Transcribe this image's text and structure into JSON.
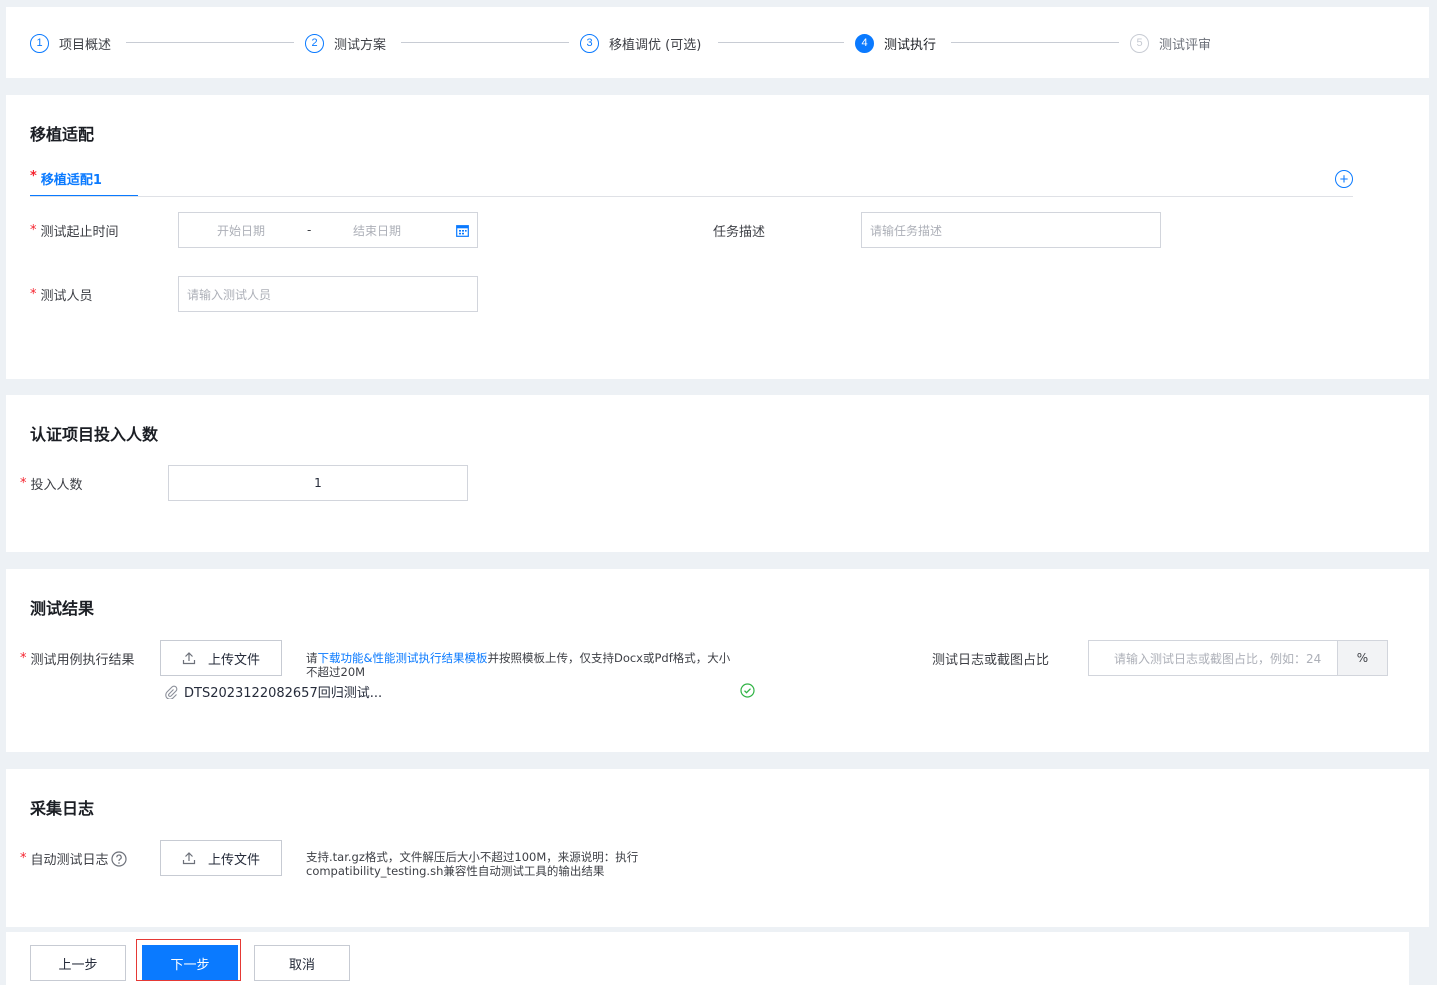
{
  "steps": [
    {
      "num": "1",
      "label": "项目概述"
    },
    {
      "num": "2",
      "label": "测试方案"
    },
    {
      "num": "3",
      "label": "移植调优 (可选)"
    },
    {
      "num": "4",
      "label": "测试执行"
    },
    {
      "num": "5",
      "label": "测试评审"
    }
  ],
  "migration": {
    "title": "移植适配",
    "tab_label": "移植适配1",
    "add_icon": "plus-circle-icon",
    "time_label": "测试起止时间",
    "start_placeholder": "开始日期",
    "range_sep": "-",
    "end_placeholder": "结束日期",
    "calendar_icon": "calendar-icon",
    "task_label": "任务描述",
    "task_placeholder": "请输任务描述",
    "people_label": "测试人员",
    "people_placeholder": "请输入测试人员"
  },
  "cert": {
    "title": "认证项目投入人数",
    "count_label": "投入人数",
    "count_value": "1"
  },
  "results": {
    "title": "测试结果",
    "case_label": "测试用例执行结果",
    "upload_label": "上传文件",
    "hint_prefix": "请",
    "hint_link": "下载功能&性能测试执行结果模板",
    "hint_line1_rest": "并按照模板上传，仅支持Docx或Pdf格式，大小",
    "hint_line2": "不超过20M",
    "file_name": "DTS2023122082657回归测试...",
    "ratio_label": "测试日志或截图占比",
    "ratio_placeholder": "请输入测试日志或截图占比，例如：24",
    "ratio_suffix": "%"
  },
  "logs": {
    "title": "采集日志",
    "auto_label": "自动测试日志",
    "help_icon": "question-circle-icon",
    "upload_label": "上传文件",
    "hint_line1": "支持.tar.gz格式，文件解压后大小不超过100M，来源说明：执行",
    "hint_line2": "compatibility_testing.sh兼容性自动测试工具的输出结果"
  },
  "footer": {
    "prev": "上一步",
    "next": "下一步",
    "cancel": "取消"
  },
  "colors": {
    "accent": "#0a7aff",
    "required": "#f5222d",
    "success": "#2fb344"
  }
}
